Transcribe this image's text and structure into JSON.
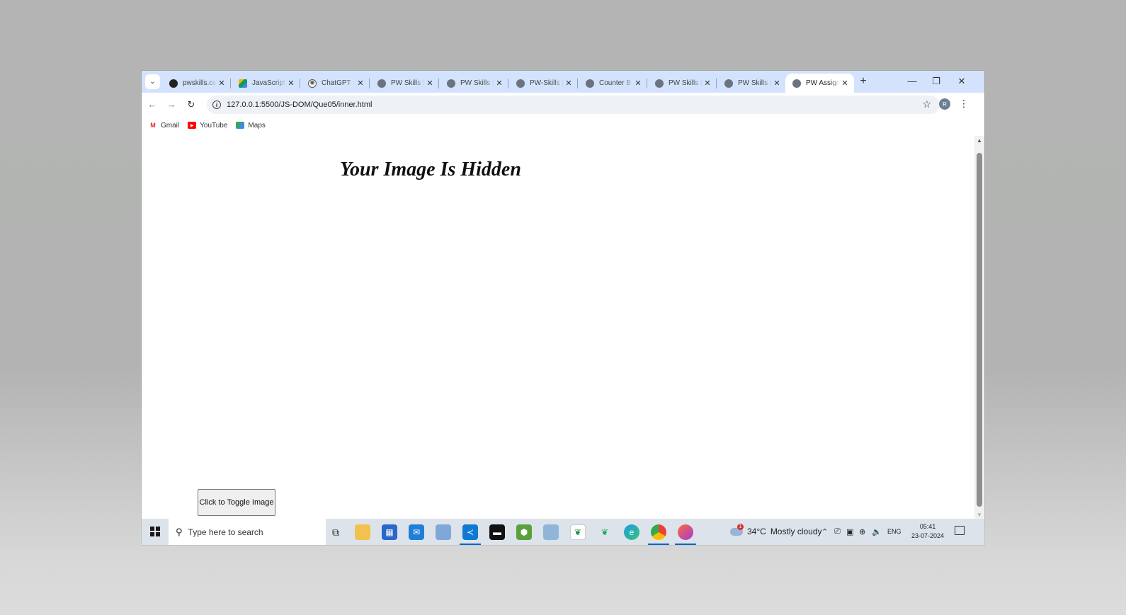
{
  "browser": {
    "tabs": [
      {
        "title": "pwskills.com",
        "favicon": "pwskills-icon",
        "color": "#222222"
      },
      {
        "title": "JavaScript",
        "favicon": "google-drive-icon",
        "color": "#f4b400"
      },
      {
        "title": "ChatGPT",
        "favicon": "chatgpt-icon",
        "color": "#555555"
      },
      {
        "title": "PW Skills |",
        "favicon": "globe-icon",
        "color": "#6b7280"
      },
      {
        "title": "PW Skills |",
        "favicon": "globe-icon",
        "color": "#6b7280"
      },
      {
        "title": "PW-Skills |",
        "favicon": "globe-icon",
        "color": "#6b7280"
      },
      {
        "title": "Counter B",
        "favicon": "globe-icon",
        "color": "#6b7280"
      },
      {
        "title": "PW Skills |",
        "favicon": "globe-icon",
        "color": "#6b7280"
      },
      {
        "title": "PW Skills |",
        "favicon": "globe-icon",
        "color": "#6b7280"
      },
      {
        "title": "PW Assign",
        "favicon": "globe-icon",
        "color": "#6b7280",
        "active": true
      }
    ],
    "url": "127.0.0.1:5500/JS-DOM/Que05/inner.html",
    "profile_initial": "R",
    "bookmarks": [
      {
        "label": "Gmail",
        "icon": "gmail-icon"
      },
      {
        "label": "YouTube",
        "icon": "youtube-icon"
      },
      {
        "label": "Maps",
        "icon": "maps-icon"
      }
    ]
  },
  "page": {
    "heading": "Your Image Is Hidden",
    "toggle_button_label": "Click to Toggle Image"
  },
  "taskbar": {
    "search_placeholder": "Type here to search",
    "weather_temp": "34°C",
    "weather_text": "Mostly cloudy",
    "weather_badge": "1",
    "language": "ENG",
    "time": "05:41",
    "date": "23-07-2024"
  },
  "colors": {
    "tab_strip": "#d3e3fd",
    "accent": "#0b63c9"
  }
}
